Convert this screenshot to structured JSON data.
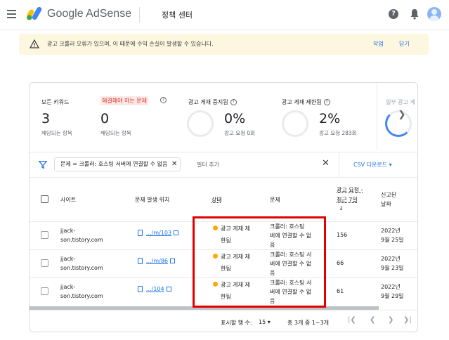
{
  "header": {
    "brand": "Google AdSense",
    "page_name": "정책 센터",
    "help_glyph": "?",
    "icons": [
      "menu-icon",
      "adsense-logo",
      "help-icon",
      "bell-icon",
      "avatar"
    ]
  },
  "banner": {
    "message": "광고 크롤러 오류가 있으며, 이 때문에 수익 손실이 발생할 수 있습니다.",
    "action_label": "작업",
    "dismiss_label": "닫기"
  },
  "summary": {
    "all_sites": {
      "label": "모든 키워드",
      "value": "3",
      "sub": "해당되는 항목"
    },
    "must_fix": {
      "label": "해결해야 하는 문제",
      "value": "0",
      "sub": "해당되는 항목"
    },
    "ad_serving_stopped": {
      "label": "광고 게재 중지됨",
      "percent": "0%",
      "sub": "광고 요청 0회"
    },
    "ad_serving_limited": {
      "label": "광고 게재 제한됨",
      "percent": "2%",
      "sub": "광고 요청 283회"
    },
    "partial_label": "일부 광고 게"
  },
  "filter": {
    "chip_label": "문제 = 크롤러: 호스팅 서버에 연결할 수 없음",
    "chip_remove": "✕",
    "add_placeholder": "필터 추가",
    "clear_glyph": "✕",
    "csv_label": "CSV 다운로드 ▾"
  },
  "table": {
    "headers": {
      "site": "사이트",
      "location": "문제 발생 위치",
      "status": "상태",
      "problem": "문제",
      "requests_line1": "광고 요청 -",
      "requests_line2": "최근 7일",
      "requests_sort": "↓",
      "date_line1": "신고된",
      "date_line2": "날짜"
    },
    "rows": [
      {
        "site_line1": "jjack-",
        "site_line2": "son.tistory.com",
        "location": ".../m/103",
        "status_line1": "광고 게재 제",
        "status_line2": "한됨",
        "problem_line1": "크롤러: 호스팅",
        "problem_line2": "버에 연결할 수 없",
        "problem_line3": "음",
        "requests": "156",
        "date_line1": "2022년",
        "date_line2": "9월 25일"
      },
      {
        "site_line1": "jjack-",
        "site_line2": "son.tistory.com",
        "location": ".../m/86",
        "status_line1": "광고 게재 제",
        "status_line2": "한됨",
        "problem_line1": "크롤러: 호스팅 서",
        "problem_line2": "버에 연결할 수 없",
        "problem_line3": "음",
        "requests": "66",
        "date_line1": "2022년",
        "date_line2": "9월 23일"
      },
      {
        "site_line1": "jjack-",
        "site_line2": "son.tistory.com",
        "location": ".../104",
        "status_line1": "광고 게재 제",
        "status_line2": "한됨",
        "problem_line1": "크롤러: 호스팅 서",
        "problem_line2": "버에 연결할 수 없",
        "problem_line3": "음",
        "requests": "61",
        "date_line1": "2022년",
        "date_line2": "9월 29일"
      }
    ]
  },
  "footer": {
    "rows_per_page_label": "표시할 행 수:",
    "rows_per_page_value": "15 ▾",
    "range_text": "총 3개 중 1~3개",
    "first": "|❮",
    "prev": "❮",
    "next": "❯",
    "last": "❯|"
  },
  "colors": {
    "accent": "#1a73e8",
    "warning": "#f9ab00",
    "banner_bg": "#fef7e0",
    "highlight": "#e00000"
  }
}
